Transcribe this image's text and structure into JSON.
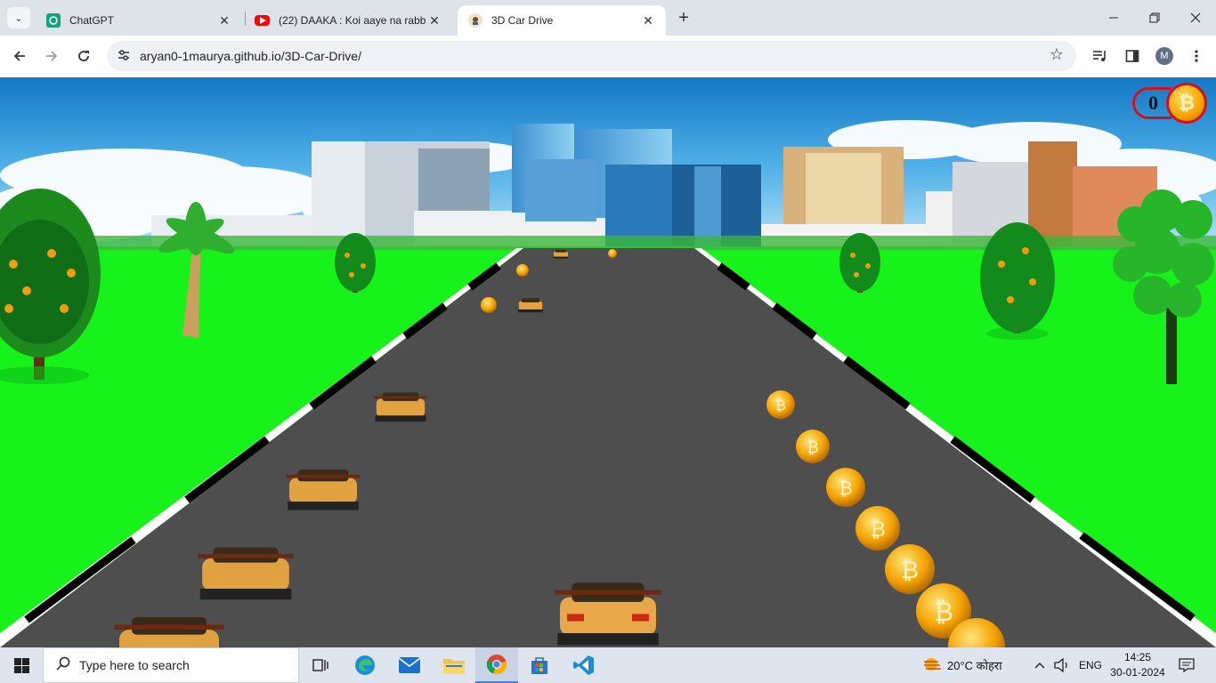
{
  "browser": {
    "tabs": [
      {
        "title": "ChatGPT",
        "active": false
      },
      {
        "title": "(22) DAAKA : Koi aaye na rabba",
        "active": false
      },
      {
        "title": "3D Car Drive",
        "active": true
      }
    ],
    "new_tab": "+",
    "url": "aryan0-1maurya.github.io/3D-Car-Drive/",
    "profile_initial": "M"
  },
  "game": {
    "score": "0",
    "coin_symbol": "₿"
  },
  "taskbar": {
    "search_placeholder": "Type here to search",
    "weather": "20°C  कोहरा",
    "language": "ENG",
    "time": "14:25",
    "date": "30-01-2024"
  },
  "colors": {
    "sky_top": "#1c8fd8",
    "grass": "#18f21b",
    "road": "#4e4e4f",
    "score_ring": "#d5101b",
    "coin": "#f5a300"
  }
}
